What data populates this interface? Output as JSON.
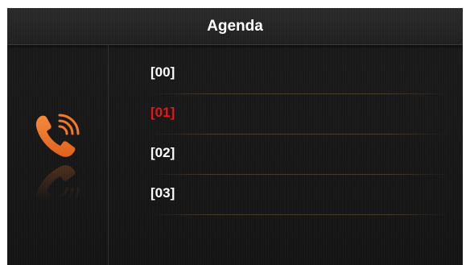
{
  "screen": {
    "title": "Agenda",
    "icon": "phone-icon",
    "accent_color": "#f07a2a",
    "selected_color": "#e8151b"
  },
  "agenda": {
    "items": [
      {
        "label": "[00]",
        "selected": false
      },
      {
        "label": "[01]",
        "selected": true
      },
      {
        "label": "[02]",
        "selected": false
      },
      {
        "label": "[03]",
        "selected": false
      }
    ]
  }
}
